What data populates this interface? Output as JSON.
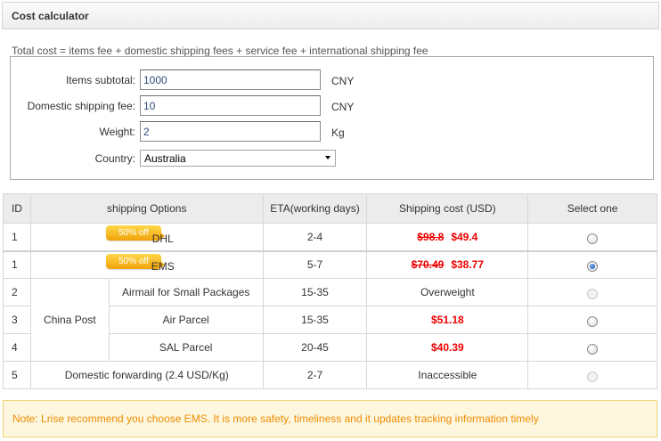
{
  "header": {
    "title": "Cost calculator"
  },
  "formula": "Total cost = items fee + domestic shipping fees + service fee + international shipping fee",
  "form": {
    "items_subtotal": {
      "label": "Items subtotal:",
      "value": "1000",
      "unit": "CNY"
    },
    "domestic_fee": {
      "label": "Domestic shipping fee:",
      "value": "10",
      "unit": "CNY"
    },
    "weight": {
      "label": "Weight:",
      "value": "2",
      "unit": "Kg"
    },
    "country": {
      "label": "Country:",
      "value": "Australia"
    }
  },
  "table": {
    "headers": [
      "ID",
      "shipping Options",
      "ETA(working days)",
      "Shipping cost (USD)",
      "Select one"
    ],
    "badge_text": "50%  off",
    "rows": [
      {
        "id": "1",
        "option": "DHL",
        "eta": "2-4",
        "old_price": "$98.8",
        "price": "$49.4",
        "selected": false,
        "disabled": false
      },
      {
        "id": "1",
        "option": "EMS",
        "eta": "5-7",
        "old_price": "$70.49",
        "price": "$38.77",
        "selected": true,
        "disabled": false
      },
      {
        "id": "2",
        "group": "China Post",
        "option": "Airmail for Small Packages",
        "eta": "15-35",
        "price": "Overweight",
        "selected": false,
        "disabled": true
      },
      {
        "id": "3",
        "option": "Air Parcel",
        "eta": "15-35",
        "price": "$51.18",
        "selected": false,
        "disabled": false
      },
      {
        "id": "4",
        "option": "SAL Parcel",
        "eta": "20-45",
        "price": "$40.39",
        "selected": false,
        "disabled": false
      },
      {
        "id": "5",
        "option": "Domestic forwarding (2.4 USD/Kg)",
        "eta": "2-7",
        "price": "Inaccessible",
        "selected": false,
        "disabled": true
      }
    ]
  },
  "note": "Note: Lrise recommend you choose EMS. It is more safety, timeliness and it updates tracking information timely",
  "colors": {
    "price_red": "#ee0000",
    "note_text": "#f08b00",
    "note_bg": "#fdf7df",
    "badge": "#f5b520"
  }
}
